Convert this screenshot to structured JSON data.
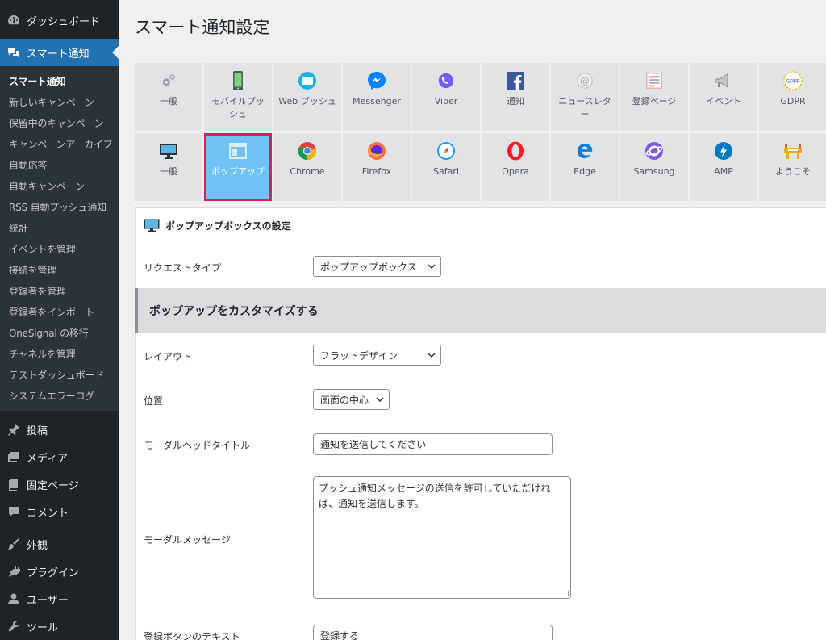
{
  "sidebar": {
    "dashboard": "ダッシュボード",
    "smart_notification": "スマート通知",
    "submenu": [
      "スマート通知",
      "新しいキャンペーン",
      "保留中のキャンペーン",
      "キャンペーンアーカイブ",
      "自動応答",
      "自動キャンペーン",
      "RSS 自動プッシュ通知",
      "統計",
      "イベントを管理",
      "接続を管理",
      "登録者を管理",
      "登録者をインポート",
      "OneSignal の移行",
      "チャネルを管理",
      "テストダッシュボード",
      "システムエラーログ"
    ],
    "posts": "投稿",
    "media": "メディア",
    "pages": "固定ページ",
    "comments": "コメント",
    "appearance": "外観",
    "plugins": "プラグイン",
    "users": "ユーザー",
    "tools": "ツール"
  },
  "page": {
    "title": "スマート通知設定"
  },
  "tabs_row1": [
    {
      "label": "一般",
      "icon": "gear-icon"
    },
    {
      "label": "モバイルプッシュ",
      "icon": "mobile-icon"
    },
    {
      "label": "Web プッシュ",
      "icon": "web-push-icon"
    },
    {
      "label": "Messenger",
      "icon": "messenger-icon"
    },
    {
      "label": "Viber",
      "icon": "viber-icon"
    },
    {
      "label": "通知",
      "icon": "facebook-icon"
    },
    {
      "label": "ニュースレター",
      "icon": "at-icon"
    },
    {
      "label": "登録ページ",
      "icon": "form-icon"
    },
    {
      "label": "イベント",
      "icon": "megaphone-icon"
    },
    {
      "label": "GDPR",
      "icon": "gdpr-icon"
    }
  ],
  "tabs_row2": [
    {
      "label": "一般",
      "icon": "monitor-icon"
    },
    {
      "label": "ポップアップ",
      "icon": "popup-icon"
    },
    {
      "label": "Chrome",
      "icon": "chrome-icon"
    },
    {
      "label": "Firefox",
      "icon": "firefox-icon"
    },
    {
      "label": "Safari",
      "icon": "safari-icon"
    },
    {
      "label": "Opera",
      "icon": "opera-icon"
    },
    {
      "label": "Edge",
      "icon": "edge-icon"
    },
    {
      "label": "Samsung",
      "icon": "samsung-icon"
    },
    {
      "label": "AMP",
      "icon": "amp-icon"
    },
    {
      "label": "ようこそ",
      "icon": "welcome-icon"
    }
  ],
  "panel": {
    "heading": "ポップアップボックスの設定",
    "request_type_label": "リクエストタイプ",
    "request_type_value": "ポップアップボックス",
    "section_title": "ポップアップをカスタマイズする",
    "layout_label": "レイアウト",
    "layout_value": "フラットデザイン",
    "position_label": "位置",
    "position_value": "画面の中心",
    "modal_title_label": "モーダルヘッドタイトル",
    "modal_title_value": "通知を送信してください",
    "modal_message_label": "モーダルメッセージ",
    "modal_message_value": "プッシュ通知メッセージの送信を許可していただければ、通知を送信します。",
    "register_button_label": "登録ボタンのテキスト",
    "register_button_value": "登録する"
  },
  "colors": {
    "sidebar_bg": "#1d2327",
    "submenu_bg": "#2c3338",
    "accent": "#2271b1",
    "active_tab": "#6ec2f5",
    "highlight": "#e8185c"
  }
}
